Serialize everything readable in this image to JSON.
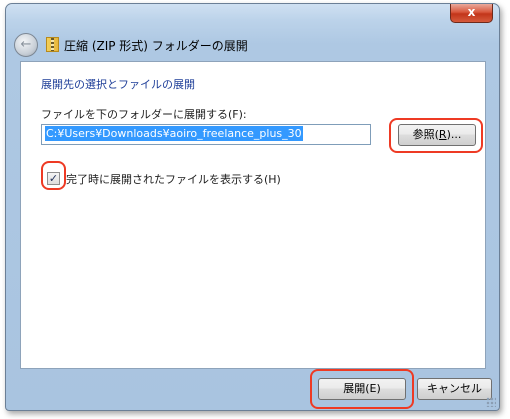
{
  "window": {
    "title": "圧縮 (ZIP 形式) フォルダーの展開",
    "close_label": "x"
  },
  "icons": {
    "back": "back-arrow-icon",
    "zip": "zip-folder-icon",
    "back_glyph": "←"
  },
  "content": {
    "heading": "展開先の選択とファイルの展開",
    "dest_label": "ファイルを下のフォルダーに展開する(F):",
    "path_value": "C:¥Users¥Downloads¥aoiro_freelance_plus_30",
    "browse_prefix": "参照(",
    "browse_key": "R",
    "browse_suffix": ")...",
    "checkbox_checked": true,
    "checkbox_mark": "✓",
    "checkbox_label": "完了時に展開されたファイルを表示する(H)"
  },
  "footer": {
    "extract_label": "展開(E)",
    "cancel_label": "キャンセル"
  },
  "colors": {
    "heading": "#1f3f99",
    "highlight": "#ee3a24",
    "selection": "#3399ff"
  }
}
